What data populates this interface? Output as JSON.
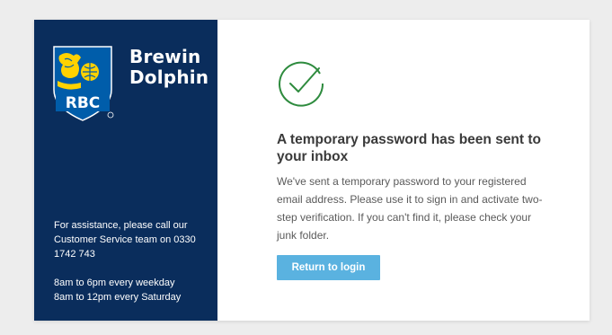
{
  "brand": {
    "logo_text": "RBC",
    "name_line1": "Brewin",
    "name_line2": "Dolphin"
  },
  "assistance": {
    "line1": "For assistance, please call our",
    "line2": "Customer Service team on 0330",
    "line3": "1742 743",
    "hours1": "8am to 6pm every weekday",
    "hours2": "8am to 12pm every Saturday"
  },
  "confirmation": {
    "icon": "check-circle-icon",
    "title": "A temporary password has been sent to your inbox",
    "message": "We've sent a temporary password to your registered email address. Please use it to sign in and activate two-step verification. If you can't find it, please check your junk folder.",
    "button_label": "Return to login"
  },
  "colors": {
    "sidebar": "#0a2d5c",
    "check": "#2e8b3e",
    "button": "#5ab2e0",
    "rbc_blue": "#005daa",
    "rbc_yellow": "#ffd200"
  }
}
